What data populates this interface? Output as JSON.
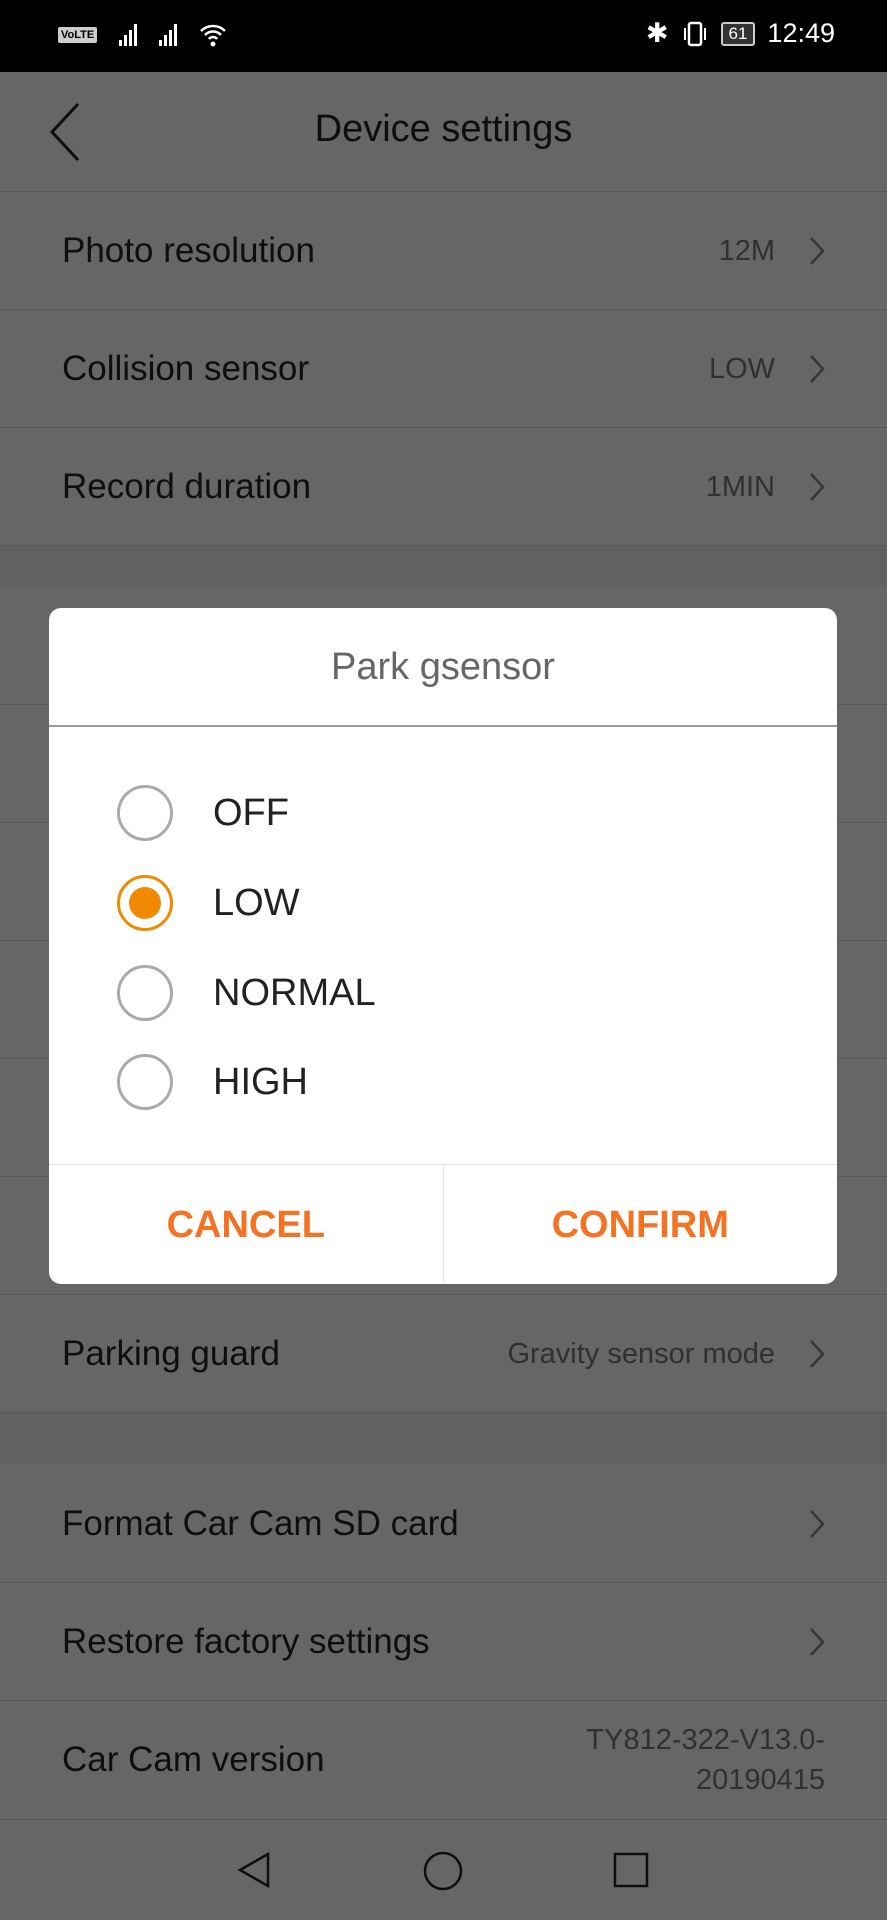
{
  "status_bar": {
    "volte": "VoLTE",
    "time": "12:49",
    "battery": "61"
  },
  "header": {
    "title": "Device settings"
  },
  "rows": [
    {
      "label": "Photo resolution",
      "value": "12M"
    },
    {
      "label": "Collision sensor",
      "value": "LOW"
    },
    {
      "label": "Record duration",
      "value": "1MIN"
    },
    {
      "label": "Parking guard",
      "value": "Gravity sensor mode"
    },
    {
      "label": "Format Car Cam SD card",
      "value": ""
    },
    {
      "label": "Restore factory settings",
      "value": ""
    },
    {
      "label": "Car Cam version",
      "value": "TY812-322-V13.0-20190415"
    }
  ],
  "dialog": {
    "title": "Park gsensor",
    "options": [
      {
        "label": "OFF"
      },
      {
        "label": "LOW"
      },
      {
        "label": "NORMAL"
      },
      {
        "label": "HIGH"
      }
    ],
    "selected": "LOW",
    "cancel": "CANCEL",
    "confirm": "CONFIRM",
    "accent": "#f57223"
  }
}
